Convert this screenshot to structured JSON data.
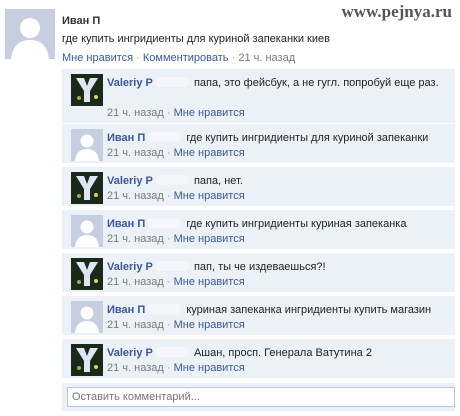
{
  "watermark": "www.pejnya.ru",
  "post": {
    "author": "Иван П",
    "text": "где купить ингридиенты для куриной запеканки киев",
    "like": "Мне нравится",
    "comment": "Комментировать",
    "time": "21 ч. назад",
    "sep": "·"
  },
  "comments": [
    {
      "author": "Valeriy P",
      "text": "папа, это фейсбук, а не гугл. попробуй еще раз.",
      "time": "21 ч. назад",
      "like": "Мне нравится",
      "avatar": "logo"
    },
    {
      "author": "Иван П",
      "text": "где купить ингридиенты для куриной запеканки",
      "time": "21 ч. назад",
      "like": "Мне нравится",
      "avatar": "default"
    },
    {
      "author": "Valeriy P",
      "text": "папа, нет.",
      "time": "21 ч. назад",
      "like": "Мне нравится",
      "avatar": "logo"
    },
    {
      "author": "Иван П",
      "text": "где купить ингридиенты куриная запеканка",
      "time": "21 ч. назад",
      "like": "Мне нравится",
      "avatar": "default"
    },
    {
      "author": "Valeriy P",
      "text": "пап, ты че издеваешься?!",
      "time": "21 ч. назад",
      "like": "Мне нравится",
      "avatar": "logo"
    },
    {
      "author": "Иван П",
      "text": "куриная запеканка ингридиенты купить магазин",
      "time": "21 ч. назад",
      "like": "Мне нравится",
      "avatar": "default"
    },
    {
      "author": "Valeriy P",
      "text": "Ашан, просп. Генерала Ватутина 2",
      "time": "21 ч. назад",
      "like": "Мне нравится",
      "avatar": "logo"
    }
  ],
  "input": {
    "placeholder": "Оставить комментарий..."
  },
  "colors": {
    "link": "#3b5998",
    "comment_bg": "#ecf0f7",
    "avatar_default": "#c7cedf"
  }
}
